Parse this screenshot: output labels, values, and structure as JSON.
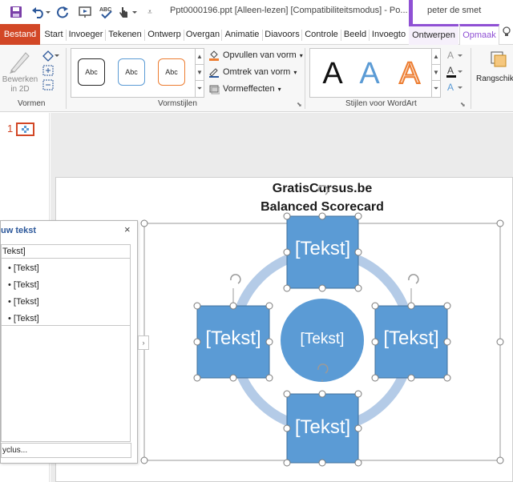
{
  "titlebar": {
    "title": "Ppt0000196.ppt [Alleen-lezen] [Compatibiliteitsmodus] - Po...",
    "user": "peter de smet",
    "qat": {
      "save_icon": "save-icon",
      "undo_icon": "undo-icon",
      "redo_icon": "redo-icon",
      "spelling_label": "ABC"
    }
  },
  "tabs": [
    {
      "label": "Bestand"
    },
    {
      "label": "Start"
    },
    {
      "label": "Invoeger"
    },
    {
      "label": "Tekenen"
    },
    {
      "label": "Ontwerp"
    },
    {
      "label": "Overgan"
    },
    {
      "label": "Animatie"
    },
    {
      "label": "Diavoors"
    },
    {
      "label": "Controle"
    },
    {
      "label": "Beeld"
    },
    {
      "label": "Invoegto"
    },
    {
      "label": "Ontwerpen"
    },
    {
      "label": "Opmaak"
    }
  ],
  "ribbon": {
    "vormen": {
      "label": "Vormen",
      "edit_label_1": "Bewerken",
      "edit_label_2": "in 2D"
    },
    "vormstijlen": {
      "label": "Vormstijlen",
      "style_swatches": [
        "Abc",
        "Abc",
        "Abc"
      ],
      "fill": "Opvullen van vorm",
      "outline": "Omtrek van vorm",
      "effects": "Vormeffecten"
    },
    "wordart": {
      "label": "Stijlen voor WordArt",
      "letters": [
        "A",
        "A",
        "A"
      ]
    },
    "arrange": {
      "label": "Rangschikken"
    }
  },
  "thumbnails": {
    "slide_number": "1"
  },
  "slide": {
    "title_line1": "GratisCursus.be",
    "title_line2": "Balanced Scorecard",
    "center_label": "[Tekst]",
    "top_label": "[Tekst]",
    "left_label": "[Tekst]",
    "right_label": "[Tekst]",
    "bottom_label": "[Tekst]"
  },
  "text_pane": {
    "title": "uw tekst",
    "close": "×",
    "first_item": "Tekst]",
    "items": [
      "[Tekst]",
      "[Tekst]",
      "[Tekst]",
      "[Tekst]"
    ],
    "bottom_link": "yclus..."
  },
  "colors": {
    "file_tab": "#d24726",
    "accent_purple": "#8f50d4",
    "box_fill": "#5b9bd5",
    "ring": "#b4cbe7"
  }
}
